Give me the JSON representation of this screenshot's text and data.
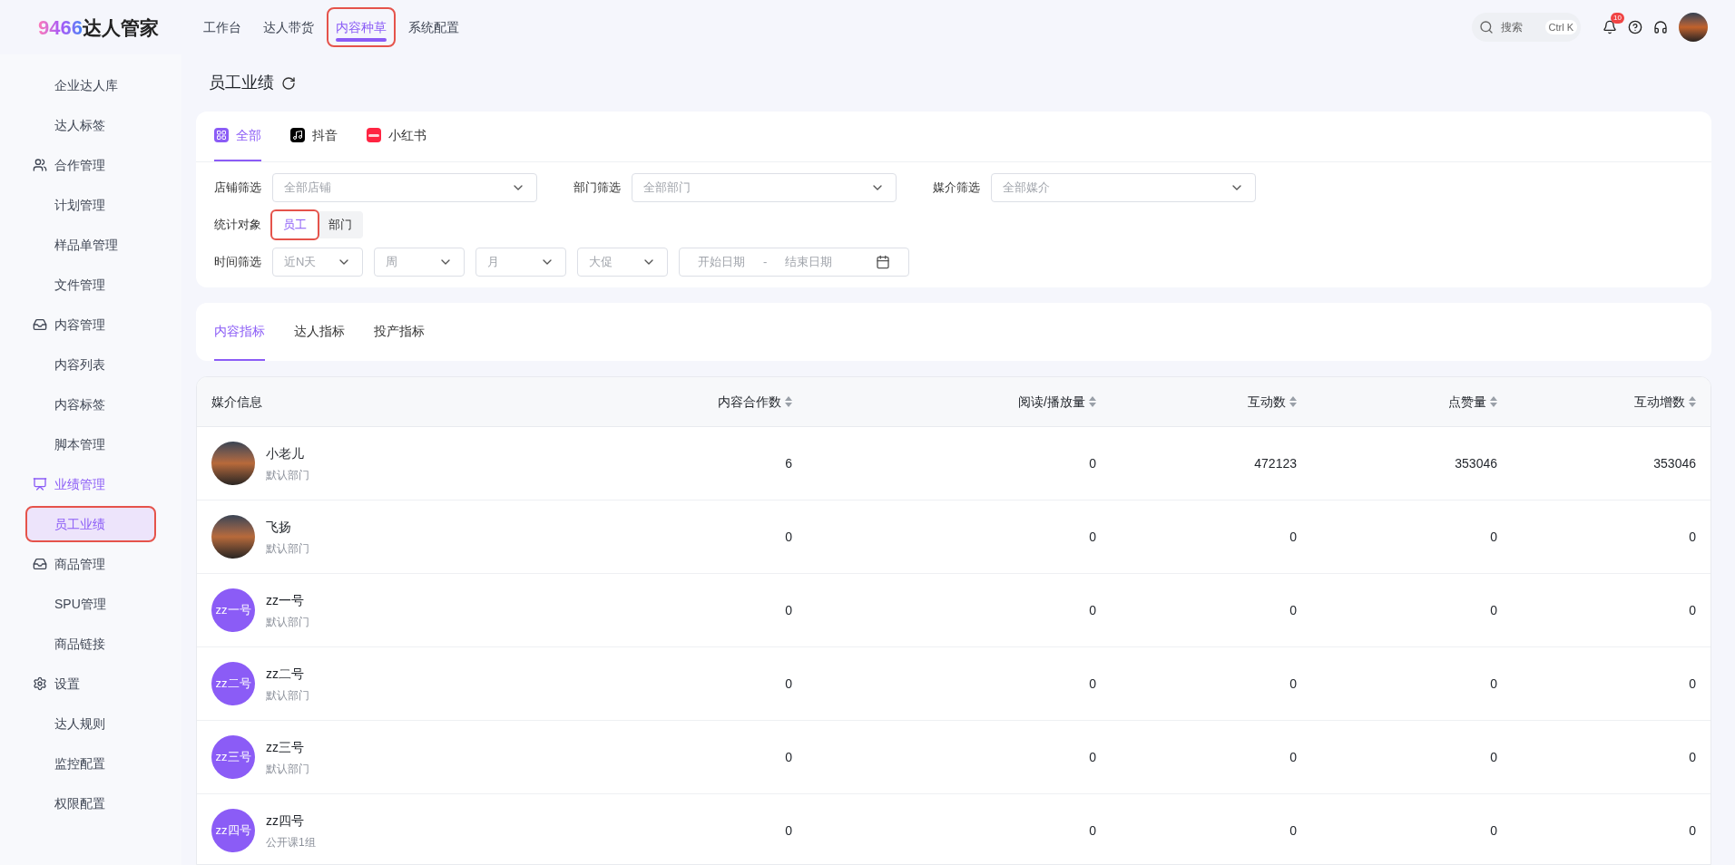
{
  "logo": {
    "digits": "9466",
    "name": "达人管家"
  },
  "top_nav": [
    {
      "label": "工作台",
      "selected": false,
      "highlighted": false
    },
    {
      "label": "达人带货",
      "selected": false,
      "highlighted": false
    },
    {
      "label": "内容种草",
      "selected": true,
      "highlighted": true
    },
    {
      "label": "系统配置",
      "selected": false,
      "highlighted": false
    }
  ],
  "search": {
    "placeholder": "搜索",
    "shortcut": "Ctrl K"
  },
  "notifications": {
    "badge": "10"
  },
  "sidebar": {
    "sections": [
      {
        "children": [
          {
            "label": "企业达人库",
            "selected": false,
            "highlighted": false
          },
          {
            "label": "达人标签",
            "selected": false,
            "highlighted": false
          }
        ]
      },
      {
        "kind": "team",
        "label": "合作管理",
        "active": false,
        "children": [
          {
            "label": "计划管理",
            "selected": false,
            "highlighted": false
          },
          {
            "label": "样品单管理",
            "selected": false,
            "highlighted": false
          },
          {
            "label": "文件管理",
            "selected": false,
            "highlighted": false
          }
        ]
      },
      {
        "kind": "tray",
        "label": "内容管理",
        "active": false,
        "children": [
          {
            "label": "内容列表",
            "selected": false,
            "highlighted": false
          },
          {
            "label": "内容标签",
            "selected": false,
            "highlighted": false
          },
          {
            "label": "脚本管理",
            "selected": false,
            "highlighted": false
          }
        ]
      },
      {
        "kind": "chart",
        "label": "业绩管理",
        "active": true,
        "children": [
          {
            "label": "员工业绩",
            "selected": true,
            "highlighted": true
          }
        ]
      },
      {
        "kind": "tray",
        "label": "商品管理",
        "active": false,
        "children": [
          {
            "label": "SPU管理",
            "selected": false,
            "highlighted": false
          },
          {
            "label": "商品链接",
            "selected": false,
            "highlighted": false
          }
        ]
      },
      {
        "kind": "gear",
        "label": "设置",
        "active": false,
        "children": [
          {
            "label": "达人规则",
            "selected": false,
            "highlighted": false
          },
          {
            "label": "监控配置",
            "selected": false,
            "highlighted": false
          },
          {
            "label": "权限配置",
            "selected": false,
            "highlighted": false
          }
        ]
      }
    ]
  },
  "page_title": "员工业绩",
  "platform_tabs": [
    {
      "label": "全部",
      "kind": "all",
      "selected": true
    },
    {
      "label": "抖音",
      "kind": "douyin",
      "selected": false
    },
    {
      "label": "小红书",
      "kind": "xiaohongshu",
      "selected": false
    }
  ],
  "filters": [
    {
      "label": "店铺筛选",
      "placeholder": "全部店铺"
    },
    {
      "label": "部门筛选",
      "placeholder": "全部部门"
    },
    {
      "label": "媒介筛选",
      "placeholder": "全部媒介"
    }
  ],
  "stat_target": {
    "label": "统计对象",
    "options": [
      {
        "label": "员工",
        "selected": true,
        "highlighted": true
      },
      {
        "label": "部门",
        "selected": false,
        "highlighted": false
      }
    ]
  },
  "time_filter": {
    "label": "时间筛选",
    "selects": [
      "近N天",
      "周",
      "月",
      "大促"
    ],
    "start_placeholder": "开始日期",
    "separator": "-",
    "end_placeholder": "结束日期"
  },
  "metric_tabs": [
    {
      "label": "内容指标",
      "selected": true
    },
    {
      "label": "达人指标",
      "selected": false
    },
    {
      "label": "投产指标",
      "selected": false
    }
  ],
  "table": {
    "columns": [
      {
        "label": "媒介信息",
        "sortable": false
      },
      {
        "label": "内容合作数",
        "sortable": true
      },
      {
        "label": "阅读/播放量",
        "sortable": true
      },
      {
        "label": "互动数",
        "sortable": true
      },
      {
        "label": "点赞量",
        "sortable": true
      },
      {
        "label": "互动增数",
        "sortable": true
      }
    ],
    "rows": [
      {
        "avatar": {
          "kind": "photo"
        },
        "name": "小老儿",
        "dept": "默认部门",
        "values": [
          "6",
          "0",
          "472123",
          "353046",
          "353046"
        ]
      },
      {
        "avatar": {
          "kind": "photo"
        },
        "name": "飞扬",
        "dept": "默认部门",
        "values": [
          "0",
          "0",
          "0",
          "0",
          "0"
        ]
      },
      {
        "avatar": {
          "kind": "text",
          "text": "zz一号"
        },
        "name": "zz一号",
        "dept": "默认部门",
        "values": [
          "0",
          "0",
          "0",
          "0",
          "0"
        ]
      },
      {
        "avatar": {
          "kind": "text",
          "text": "zz二号"
        },
        "name": "zz二号",
        "dept": "默认部门",
        "values": [
          "0",
          "0",
          "0",
          "0",
          "0"
        ]
      },
      {
        "avatar": {
          "kind": "text",
          "text": "zz三号"
        },
        "name": "zz三号",
        "dept": "默认部门",
        "values": [
          "0",
          "0",
          "0",
          "0",
          "0"
        ]
      },
      {
        "avatar": {
          "kind": "text",
          "text": "zz四号"
        },
        "name": "zz四号",
        "dept": "公开课1组",
        "values": [
          "0",
          "0",
          "0",
          "0",
          "0"
        ]
      }
    ]
  }
}
